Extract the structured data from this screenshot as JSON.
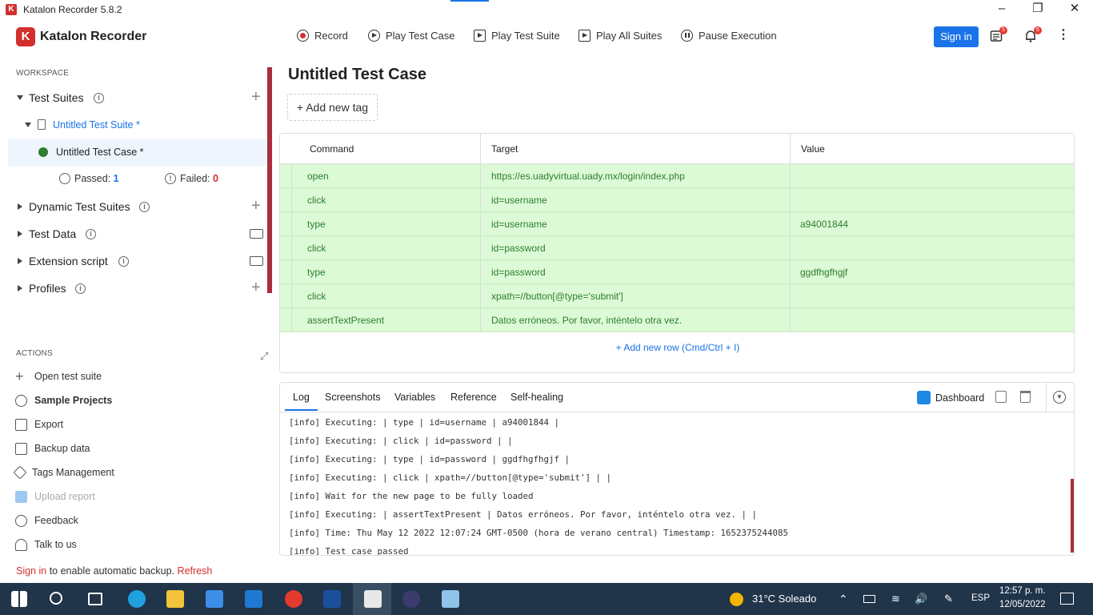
{
  "window": {
    "title": "Katalon Recorder 5.8.2",
    "logo_letter": "K"
  },
  "header": {
    "brand": "Katalon Recorder",
    "buttons": [
      "Record",
      "Play Test Case",
      "Play Test Suite",
      "Play All Suites",
      "Pause Execution"
    ],
    "sign_in": "Sign in",
    "badge_logs": "5",
    "badge_notifications": "6",
    "colors": {
      "accent": "#1a73e8",
      "brand": "#d32f2f"
    }
  },
  "sidebar": {
    "workspace_label": "WORKSPACE",
    "test_suites": "Test Suites",
    "suite_name": "Untitled Test Suite *",
    "case_name": "Untitled Test Case *",
    "passed_label": "Passed:",
    "passed_count": "1",
    "failed_label": "Failed:",
    "failed_count": "0",
    "dynamic_suites": "Dynamic Test Suites",
    "test_data": "Test Data",
    "extension_script": "Extension script",
    "profiles": "Profiles",
    "actions_label": "ACTIONS",
    "actions": [
      "Open test suite",
      "Sample Projects",
      "Export",
      "Backup data",
      "Tags Management",
      "Upload report",
      "Feedback",
      "Talk to us"
    ],
    "footnote_link": "Sign in",
    "footnote_text": " to enable automatic backup. ",
    "footnote_refresh": "Refresh"
  },
  "main": {
    "title": "Untitled Test Case",
    "add_tag": "+ Add new tag",
    "columns": [
      "Command",
      "Target",
      "Value"
    ],
    "rows": [
      {
        "command": "open",
        "target": "https://es.uadyvirtual.uady.mx/login/index.php",
        "value": ""
      },
      {
        "command": "click",
        "target": "id=username",
        "value": ""
      },
      {
        "command": "type",
        "target": "id=username",
        "value": "a94001844"
      },
      {
        "command": "click",
        "target": "id=password",
        "value": ""
      },
      {
        "command": "type",
        "target": "id=password",
        "value": "ggdfhgfhgjf"
      },
      {
        "command": "click",
        "target": "xpath=//button[@type='submit']",
        "value": ""
      },
      {
        "command": "assertTextPresent",
        "target": "Datos erróneos. Por favor, inténtelo otra vez.",
        "value": ""
      }
    ],
    "add_row": "+ Add new row (Cmd/Ctrl + I)"
  },
  "log": {
    "tabs": [
      "Log",
      "Screenshots",
      "Variables",
      "Reference",
      "Self-healing"
    ],
    "dashboard": "Dashboard",
    "lines": [
      "[info] Executing: | type | id=username | a94001844 |",
      "[info] Executing: | click | id=password | |",
      "[info] Executing: | type | id=password | ggdfhgfhgjf |",
      "[info] Executing: | click | xpath=//button[@type='submit'] | |",
      "[info] Wait for the new page to be fully loaded",
      "[info] Executing: | assertTextPresent | Datos erróneos. Por favor, inténtelo otra vez. | |",
      "[info] Time: Thu May 12 2022 12:07:24 GMT-0500 (hora de verano central) Timestamp: 1652375244085",
      "[info] Test case passed"
    ]
  },
  "taskbar": {
    "weather": "31°C  Soleado",
    "lang": "ESP",
    "time": "12:57 p. m.",
    "date": "12/05/2022"
  }
}
